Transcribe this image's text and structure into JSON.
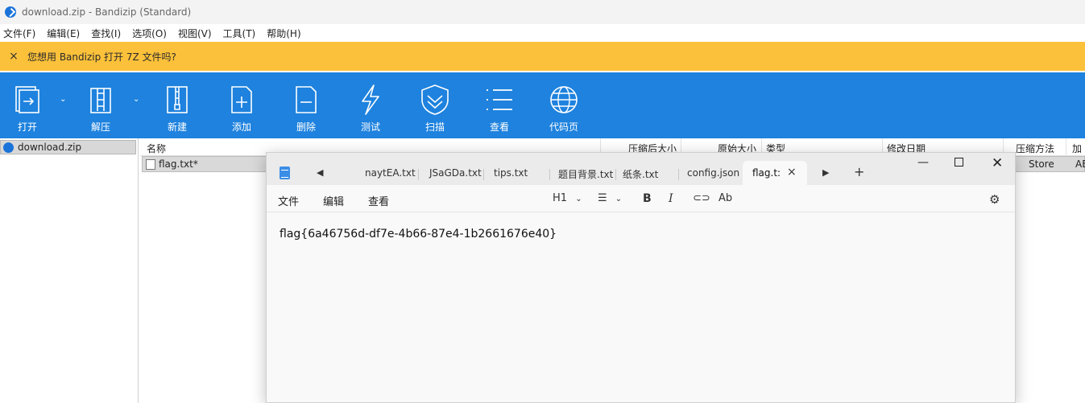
{
  "window": {
    "title": "download.zip - Bandizip (Standard)"
  },
  "menubar": [
    "文件(F)",
    "编辑(E)",
    "查找(I)",
    "选项(O)",
    "视图(V)",
    "工具(T)",
    "帮助(H)"
  ],
  "notification": {
    "close": "×",
    "message": "您想用 Bandizip 打开 7Z 文件吗?"
  },
  "colors": {
    "toolbar": "#1e82de",
    "notification": "#fcc13a"
  },
  "toolbar": {
    "open": "打开",
    "extract": "解压",
    "new": "新建",
    "add": "添加",
    "delete": "删除",
    "test": "测试",
    "scan": "扫描",
    "view": "查看",
    "codepage": "代码页"
  },
  "tree": {
    "root": "download.zip"
  },
  "filelist": {
    "columns": {
      "name": "名称",
      "compressed": "压缩后大小",
      "original": "原始大小",
      "type": "类型",
      "modified": "修改日期",
      "method": "压缩方法",
      "encrypt": "加密"
    },
    "rows": [
      {
        "name": "flag.txt*",
        "method": "Store",
        "encrypt": "AE"
      }
    ]
  },
  "notepad": {
    "tabs": [
      "naytEA.txt",
      "JSaGDa.txt",
      "tips.txt",
      "题目背景.txt",
      "纸条.txt",
      "config.json"
    ],
    "active_tab": "flag.t:",
    "close_tab": "×",
    "new_tab": "+",
    "menu": {
      "file": "文件",
      "edit": "编辑",
      "view": "查看"
    },
    "format": {
      "heading": "H1",
      "bold": "B",
      "italic": "I"
    },
    "content": "flag{6a46756d-df7e-4b66-87e4-1b2661676e40}"
  }
}
